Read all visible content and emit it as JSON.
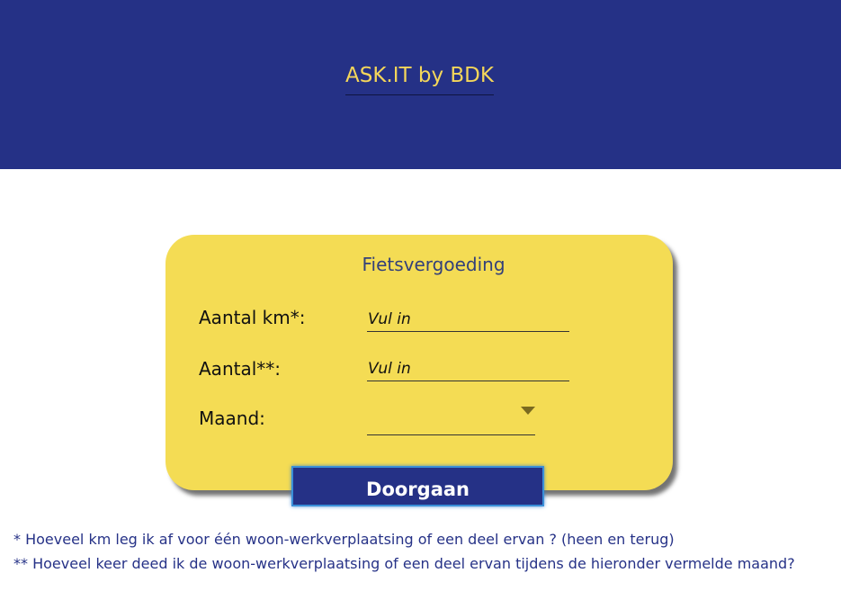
{
  "header": {
    "brand": "ASK.IT by BDK",
    "background_color": "#253186",
    "brand_color": "#f4d65a"
  },
  "form": {
    "title": "Fietsvergoeding",
    "card_color": "#f4dc54",
    "fields": [
      {
        "label": "Aantal km*:",
        "placeholder": "Vul in",
        "value": ""
      },
      {
        "label": "Aantal**:",
        "placeholder": "Vul in",
        "value": ""
      }
    ],
    "month": {
      "label": "Maand:",
      "selected": "",
      "icon": "chevron-down-icon"
    },
    "submit_label": "Doorgaan"
  },
  "footnotes": [
    "* Hoeveel km leg ik af voor één woon-werkverplaatsing of een deel ervan ? (heen en terug)",
    "** Hoeveel keer deed ik de woon-werkverplaatsing of een deel ervan tijdens de hieronder vermelde maand?"
  ]
}
